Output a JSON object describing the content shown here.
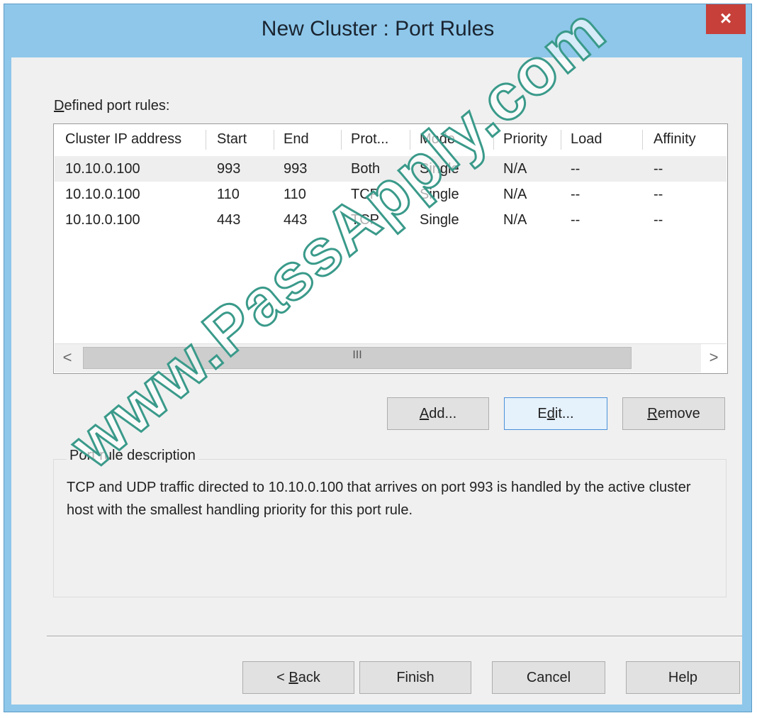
{
  "window": {
    "title": "New Cluster : Port Rules",
    "close_label": "×"
  },
  "port_rules": {
    "label_first": "D",
    "label_rest": "efined port rules:",
    "columns": [
      "Cluster IP address",
      "Start",
      "End",
      "Prot...",
      "Mode",
      "Priority",
      "Load",
      "Affinity"
    ],
    "rows": [
      [
        "10.10.0.100",
        "993",
        "993",
        "Both",
        "Single",
        "N/A",
        "--",
        "--"
      ],
      [
        "10.10.0.100",
        "110",
        "110",
        "TCP",
        "Single",
        "N/A",
        "--",
        "--"
      ],
      [
        "10.10.0.100",
        "443",
        "443",
        "TCP",
        "Single",
        "N/A",
        "--",
        "--"
      ]
    ],
    "scroll_grip": "III",
    "scroll_left": "<",
    "scroll_right": ">"
  },
  "buttons": {
    "add_first": "A",
    "add_rest": "dd...",
    "edit_pre": "E",
    "edit_u": "d",
    "edit_post": "it...",
    "remove_first": "R",
    "remove_rest": "emove",
    "back_pre": "< ",
    "back_u": "B",
    "back_post": "ack",
    "finish": "Finish",
    "cancel": "Cancel",
    "help": "Help"
  },
  "description": {
    "title": "Port rule description",
    "text": "TCP and UDP traffic directed to 10.10.0.100 that arrives on port 993 is handled by the active cluster host with the smallest handling priority for this port rule."
  },
  "watermark": "www.PassApply.com"
}
